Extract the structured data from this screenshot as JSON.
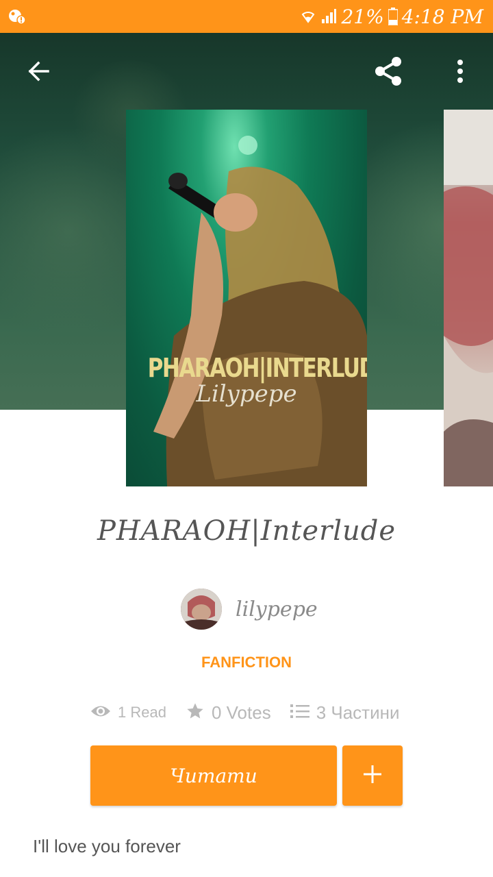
{
  "status_bar": {
    "battery": "21%",
    "time": "4:18 PM",
    "icons": [
      "notification-icon",
      "wifi-icon",
      "signal-icon",
      "battery-icon"
    ]
  },
  "toolbar": {
    "back_icon": "arrow-back-icon",
    "share_icon": "share-icon",
    "menu_icon": "more-vert-icon"
  },
  "cover": {
    "title_text": "PHARAOH|INTERLUDE",
    "author_text": "Lilypepe"
  },
  "story": {
    "title": "PHARAOH|Interlude",
    "author": "lilypepe",
    "category": "FANFICTION",
    "stats": {
      "reads": "1 Read",
      "votes": "0 Votes",
      "parts": "3 Частини"
    },
    "read_button_label": "Читати",
    "add_button_icon": "plus-icon",
    "description": "I'll love you forever"
  },
  "colors": {
    "accent": "#ff9419",
    "stat_gray": "#b8b8b8",
    "title_gray": "#555555"
  }
}
